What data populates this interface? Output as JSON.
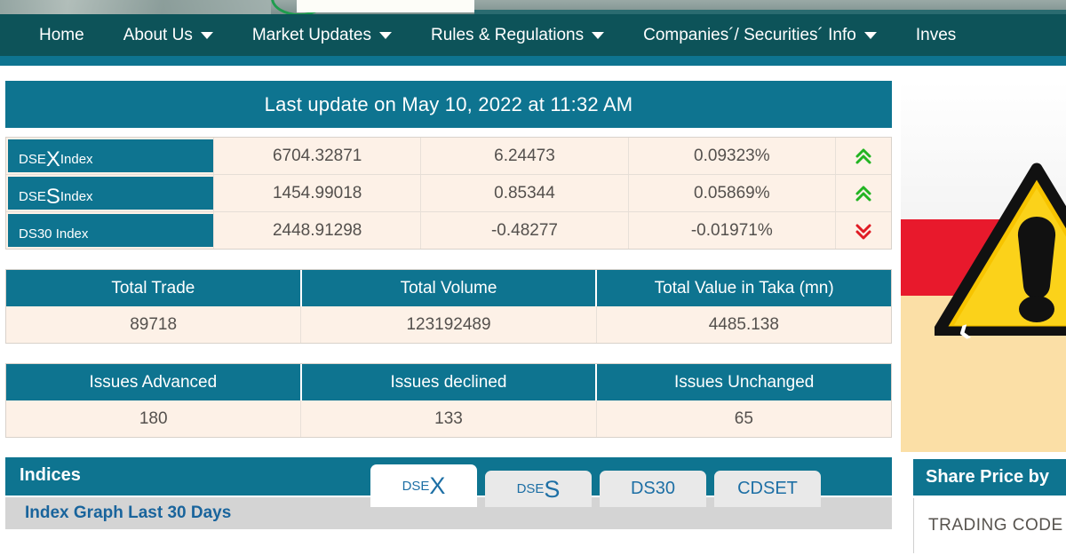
{
  "nav": {
    "items": [
      {
        "label": "Home",
        "has_caret": false,
        "icon": ""
      },
      {
        "label": "About Us",
        "has_caret": true,
        "icon": "chevron-down-icon"
      },
      {
        "label": "Market Updates",
        "has_caret": true,
        "icon": "chevron-down-icon"
      },
      {
        "label": "Rules & Regulations",
        "has_caret": true,
        "icon": "chevron-down-icon"
      },
      {
        "label": "Companies´/ Securities´ Info",
        "has_caret": true,
        "icon": "chevron-down-icon"
      },
      {
        "label": "Inves",
        "has_caret": false,
        "icon": ""
      }
    ]
  },
  "last_update": {
    "text": "Last update on May 10, 2022 at 11:32 AM"
  },
  "indices": {
    "rows": [
      {
        "name_prefix": "DSE",
        "name_big": "X",
        "name_suffix": " Index",
        "value": "6704.32871",
        "change": "6.24473",
        "percent": "0.09323%",
        "direction": "up",
        "arrow_icon": "double-chevron-up-icon"
      },
      {
        "name_prefix": "DSE",
        "name_big": "S",
        "name_suffix": " Index",
        "value": "1454.99018",
        "change": "0.85344",
        "percent": "0.05869%",
        "direction": "up",
        "arrow_icon": "double-chevron-up-icon"
      },
      {
        "name_prefix": "DS30 Index",
        "name_big": "",
        "name_suffix": "",
        "value": "2448.91298",
        "change": "-0.48277",
        "percent": "-0.01971%",
        "direction": "down",
        "arrow_icon": "double-chevron-down-icon"
      }
    ]
  },
  "totals": {
    "headers": [
      "Total Trade",
      "Total Volume",
      "Total Value in Taka (mn)"
    ],
    "values": [
      "89718",
      "123192489",
      "4485.138"
    ]
  },
  "issues": {
    "headers": [
      "Issues Advanced",
      "Issues declined",
      "Issues Unchanged"
    ],
    "values": [
      "180",
      "133",
      "65"
    ]
  },
  "indices_panel": {
    "title": "Indices",
    "tabs": [
      {
        "prefix": "DSE",
        "big": "X",
        "label": "DSEX",
        "active": true
      },
      {
        "prefix": "DSE",
        "big": "S",
        "label": "DSES",
        "active": false
      },
      {
        "prefix": "DS30",
        "big": "",
        "label": "DS30",
        "active": false
      },
      {
        "prefix": "CDSET",
        "big": "",
        "label": "CDSET",
        "active": false
      }
    ],
    "graph_header": "Index Graph Last 30 Days"
  },
  "right": {
    "carousel_prev_icon": "chevron-left-icon",
    "promo_icon": "warning-triangle-icon",
    "share_price_title": "Share Price by",
    "trading_code_label": "TRADING CODE"
  },
  "colors": {
    "nav_bg": "#0d5359",
    "accent_teal": "#0e7490",
    "cell_bg": "#fdf1e7",
    "up_green": "#22b422",
    "down_red": "#e01b24",
    "tab_blue": "#1d6fa5",
    "promo_red": "#e8192c",
    "promo_cream": "#fbdfa6",
    "warning_yellow": "#f7c400"
  }
}
